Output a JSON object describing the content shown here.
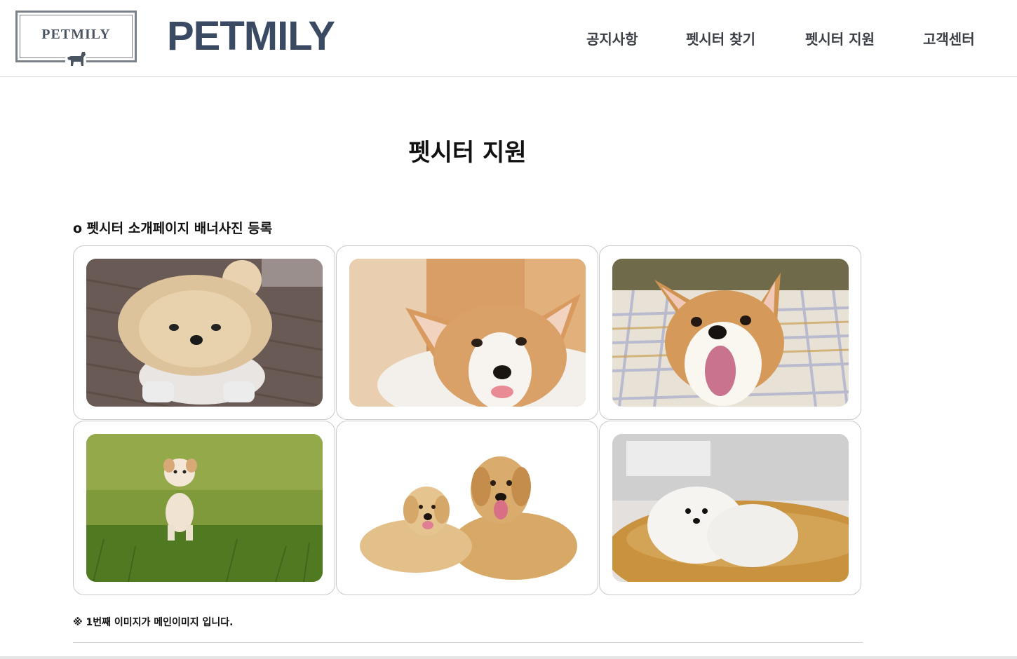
{
  "header": {
    "logo_text": "PETMILY",
    "brand": "PETMILY",
    "nav": [
      "공지사항",
      "펫시터 찾기",
      "펫시터 지원",
      "고객센터"
    ]
  },
  "main": {
    "title": "펫시터 지원",
    "section_label": "o 펫시터 소개페이지 배너사진 등록",
    "photos": [
      {
        "subject": "pomeranian-beige-on-wood-floor"
      },
      {
        "subject": "corgi-lying-indoors"
      },
      {
        "subject": "corgi-on-plaid-blanket"
      },
      {
        "subject": "puppy-standing-on-grass"
      },
      {
        "subject": "two-golden-retrievers"
      },
      {
        "subject": "white-pomeranian-on-cushion"
      }
    ],
    "note": "※ 1번째 이미지가 메인이미지 입니다."
  },
  "colors": {
    "brand": "#3a4a63",
    "nav_text": "#3b3f45",
    "card_border": "#c9c9c9"
  }
}
